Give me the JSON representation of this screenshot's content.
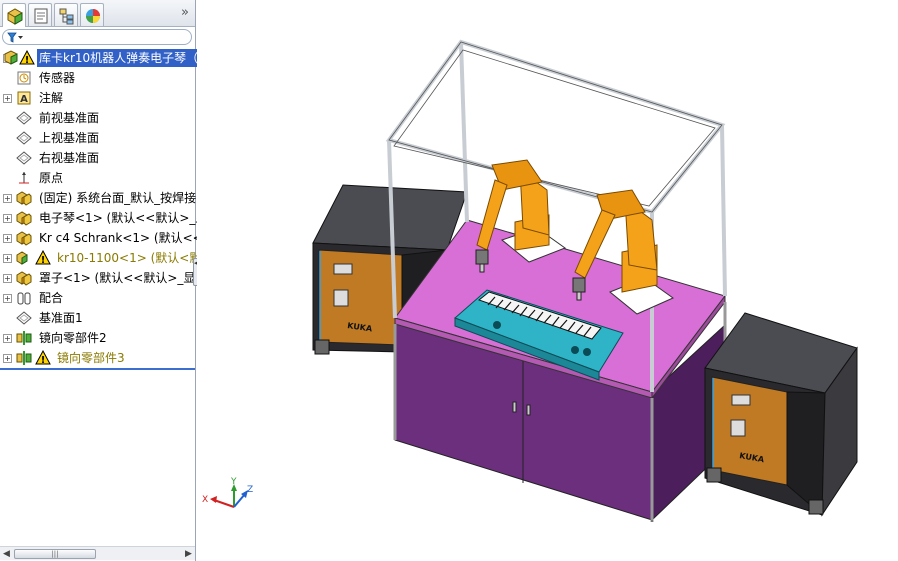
{
  "panel": {
    "tabs": [
      {
        "name": "feature-manager-tab",
        "icon": "feature-tree-icon"
      },
      {
        "name": "property-manager-tab",
        "icon": "property-icon"
      },
      {
        "name": "configuration-manager-tab",
        "icon": "configuration-icon"
      },
      {
        "name": "display-manager-tab",
        "icon": "appearance-pie-icon"
      }
    ],
    "more": "»",
    "filter_icon": "filter-funnel-icon"
  },
  "tree": {
    "root": "库卡kr10机器人弹奏电子琴（",
    "items": [
      {
        "label": "传感器",
        "icon": "sensor-icon",
        "expand": false
      },
      {
        "label": "注解",
        "icon": "annotation-icon",
        "expand": true
      },
      {
        "label": "前视基准面",
        "icon": "plane-icon",
        "expand": false
      },
      {
        "label": "上视基准面",
        "icon": "plane-icon",
        "expand": false
      },
      {
        "label": "右视基准面",
        "icon": "plane-icon",
        "expand": false
      },
      {
        "label": "原点",
        "icon": "origin-icon",
        "expand": false
      },
      {
        "label": "(固定) 系统台面_默认_按焊接",
        "icon": "subassembly-icon",
        "expand": true
      },
      {
        "label": "电子琴<1> (默认<<默认>_显",
        "icon": "subassembly-icon",
        "expand": true
      },
      {
        "label": "Kr c4 Schrank<1> (默认<<",
        "icon": "subassembly-icon",
        "expand": true
      },
      {
        "label": "kr10-1100<1> (默认<默",
        "icon": "subassembly-warn-icon",
        "expand": true,
        "warn": true
      },
      {
        "label": "罩子<1> (默认<<默认>_显示",
        "icon": "subassembly-icon",
        "expand": true
      },
      {
        "label": "配合",
        "icon": "mates-icon",
        "expand": true
      },
      {
        "label": "基准面1",
        "icon": "plane-icon",
        "expand": false
      },
      {
        "label": "镜向零部件2",
        "icon": "mirror-component-icon",
        "expand": true
      },
      {
        "label": "镜向零部件3",
        "icon": "mirror-component-icon",
        "expand": true,
        "warn": true
      }
    ]
  },
  "scroll": {
    "left": "◀",
    "right": "▶",
    "grip": "|||"
  },
  "splitter": "◀▶",
  "viewport": {
    "triad": {
      "x": "X",
      "y": "Y",
      "z": "Z"
    },
    "brand": "KUKA",
    "colors": {
      "frame": "#c8cdd4",
      "table_top": "#d86fd6",
      "cabinet": "#6c2f7e",
      "controller": "#2a2a2e",
      "controller_front": "#c07a24",
      "robot": "#f4a21a",
      "keyboard": "#2fb3c7"
    }
  }
}
